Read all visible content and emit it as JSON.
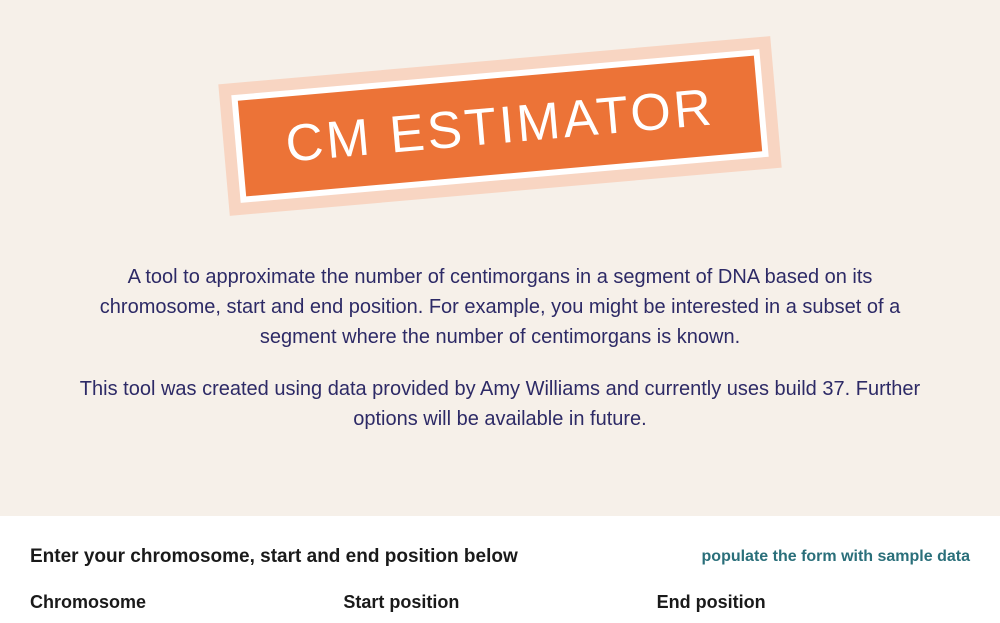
{
  "hero": {
    "banner_title": "CM ESTIMATOR",
    "paragraph1": "A tool to approximate the number of centimorgans in a segment of DNA based on its chromosome, start and end position. For example, you might be interested in a subset of a segment where the number of centimorgans is known.",
    "paragraph2": "This tool was created using data provided by Amy Williams and currently uses build 37. Further options will be available in future."
  },
  "form": {
    "heading": "Enter your chromosome, start and end position below",
    "sample_link": "populate the form with sample data",
    "fields": {
      "chromosome_label": "Chromosome",
      "start_label": "Start position",
      "end_label": "End position"
    }
  }
}
